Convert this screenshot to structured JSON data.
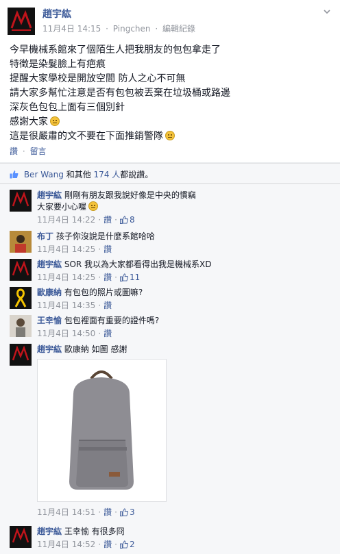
{
  "post": {
    "author": "趙宇紘",
    "date": "11月4日 14:15",
    "location": "Pingchen",
    "edit_history": "編輯紀錄",
    "meta_sep": "·",
    "lines": [
      "今早機械系館來了個陌生人把我朋友的包包拿走了",
      "特徵是染髮臉上有疤痕",
      "提醒大家學校是開放空間 防人之心不可無",
      "請大家多幫忙注意是否有包包被丟棄在垃圾桶或路邊",
      "深灰色包包上面有三個別針",
      "感謝大家",
      "這是很嚴肅的文不要在下面推銷警隊"
    ],
    "actions": {
      "like": "讚",
      "comment": "留言",
      "sep": "·"
    }
  },
  "likes": {
    "first": "Ber Wang",
    "and_others": "和其他",
    "count": "174 人",
    "suffix": "都說讚。"
  },
  "comments": [
    {
      "author": "趙宇紘",
      "lines": [
        "剛剛有朋友跟我說好像是中央的慣竊",
        "大家要小心喔"
      ],
      "date": "11月4日 14:22",
      "like": "讚",
      "likes": "8",
      "avatar": "logo"
    },
    {
      "author": "布丁",
      "lines": [
        "孩子你沒說是什麼系館哈哈"
      ],
      "date": "11月4日 14:25",
      "like": "讚",
      "likes": "",
      "avatar": "person"
    },
    {
      "author": "趙宇紘",
      "lines": [
        "SOR 我以為大家都看得出我是機械系XD"
      ],
      "date": "11月4日 14:25",
      "like": "讚",
      "likes": "11",
      "avatar": "logo"
    },
    {
      "author": "歐康納",
      "lines": [
        "有包包的照片或圖嘛?"
      ],
      "date": "11月4日 14:35",
      "like": "讚",
      "likes": "",
      "avatar": "ribbon"
    },
    {
      "author": "王幸愉",
      "lines": [
        "包包裡面有重要的證件嗎?"
      ],
      "date": "11月4日 14:50",
      "like": "讚",
      "likes": "",
      "avatar": "photo"
    },
    {
      "author": "趙宇紘",
      "lines": [
        "歐康納 如圖 感謝"
      ],
      "date": "11月4日 14:51",
      "like": "讚",
      "likes": "3",
      "avatar": "logo"
    },
    {
      "author": "趙宇紘",
      "lines": [
        "王幸愉 有很多冏"
      ],
      "date": "11月4日 14:52",
      "like": "讚",
      "likes": "2",
      "avatar": "logo"
    }
  ],
  "logo_text": "MECHE",
  "colors": {
    "link": "#3b5998",
    "meta": "#90949c",
    "bag": "#8e8d93",
    "avatar_bg": "#111111",
    "avatar_red": "#c0141b"
  }
}
